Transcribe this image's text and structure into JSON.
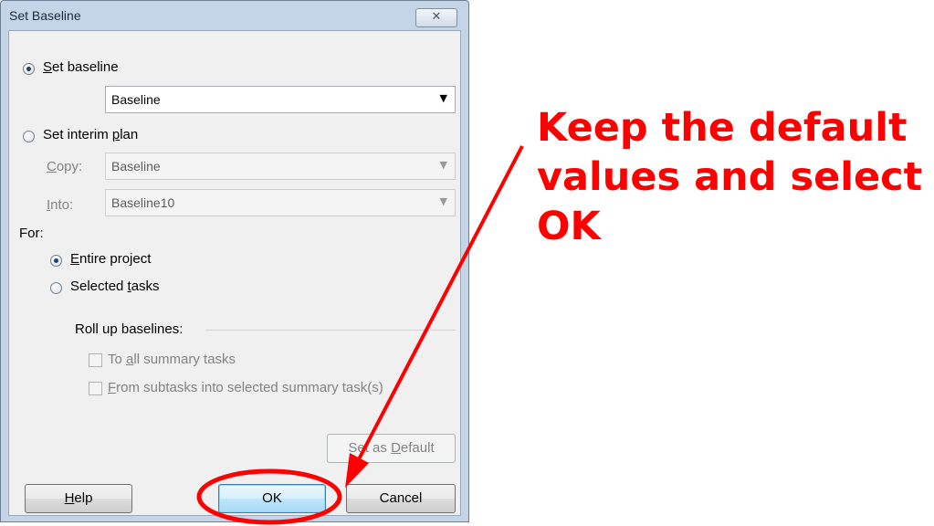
{
  "dialog": {
    "title": "Set Baseline",
    "close_glyph": "✕",
    "set_baseline": {
      "prefix": "",
      "accel": "S",
      "rest": "et baseline",
      "selected": true
    },
    "baseline_select": {
      "value": "Baseline"
    },
    "set_interim": {
      "prefix": "Set interim ",
      "accel": "p",
      "rest": "lan",
      "selected": false
    },
    "copy": {
      "label_accel": "C",
      "label_rest": "opy:",
      "value": "Baseline"
    },
    "into": {
      "label_accel": "I",
      "label_rest": "nto:",
      "value": "Baseline10"
    },
    "for_label": "For:",
    "entire_project": {
      "prefix": "",
      "accel": "E",
      "rest": "ntire project",
      "selected": true
    },
    "selected_tasks": {
      "prefix": "Selected ",
      "accel": "t",
      "rest": "asks",
      "selected": false
    },
    "rollup_label": "Roll up baselines:",
    "to_all_summary": {
      "prefix": "To ",
      "accel": "a",
      "rest": "ll summary tasks",
      "checked": false
    },
    "from_subtasks": {
      "prefix": "",
      "accel": "F",
      "rest": "rom subtasks into selected summary task(s)",
      "checked": false
    },
    "set_as_default": {
      "prefix": "Set as ",
      "accel": "D",
      "rest": "efault"
    },
    "help_button": {
      "accel": "H",
      "rest": "elp"
    },
    "ok_button": "OK",
    "cancel_button": "Cancel"
  },
  "annotation": {
    "line1": "Keep the default",
    "line2": "values and select",
    "line3": "OK",
    "color": "#ff0000"
  },
  "colors": {
    "accent": "#ff0000",
    "dialog_frame": "#c4d5e8",
    "client_bg": "#f0f0f0"
  }
}
